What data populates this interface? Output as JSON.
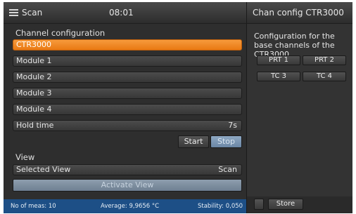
{
  "header": {
    "title": "Scan",
    "time": "08:01"
  },
  "channel_config": {
    "label": "Channel configuration",
    "items": [
      {
        "label": "CTR3000",
        "selected": true
      },
      {
        "label": "Module 1",
        "selected": false
      },
      {
        "label": "Module 2",
        "selected": false
      },
      {
        "label": "Module 3",
        "selected": false
      },
      {
        "label": "Module 4",
        "selected": false
      }
    ],
    "hold_time": {
      "label": "Hold time",
      "value": "7s"
    }
  },
  "controls": {
    "start": "Start",
    "stop": "Stop"
  },
  "view": {
    "label": "View",
    "selected_label": "Selected View",
    "selected_value": "Scan",
    "activate": "Activate View"
  },
  "status": {
    "meas": "No of meas: 10",
    "average": "Average: 9,9656 °C",
    "stability": "Stability: 0,050"
  },
  "right_panel": {
    "title": "Chan config CTR3000",
    "description": "Configuration for the base channels of the CTR3000",
    "channels": [
      "PRT 1",
      "PRT 2",
      "TC 3",
      "TC 4"
    ],
    "store": "Store"
  },
  "icons": {
    "menu": "menu-icon"
  },
  "colors": {
    "selected": "#f08a24",
    "statusbar": "#1d4f86",
    "stop": "#7c96b2"
  }
}
